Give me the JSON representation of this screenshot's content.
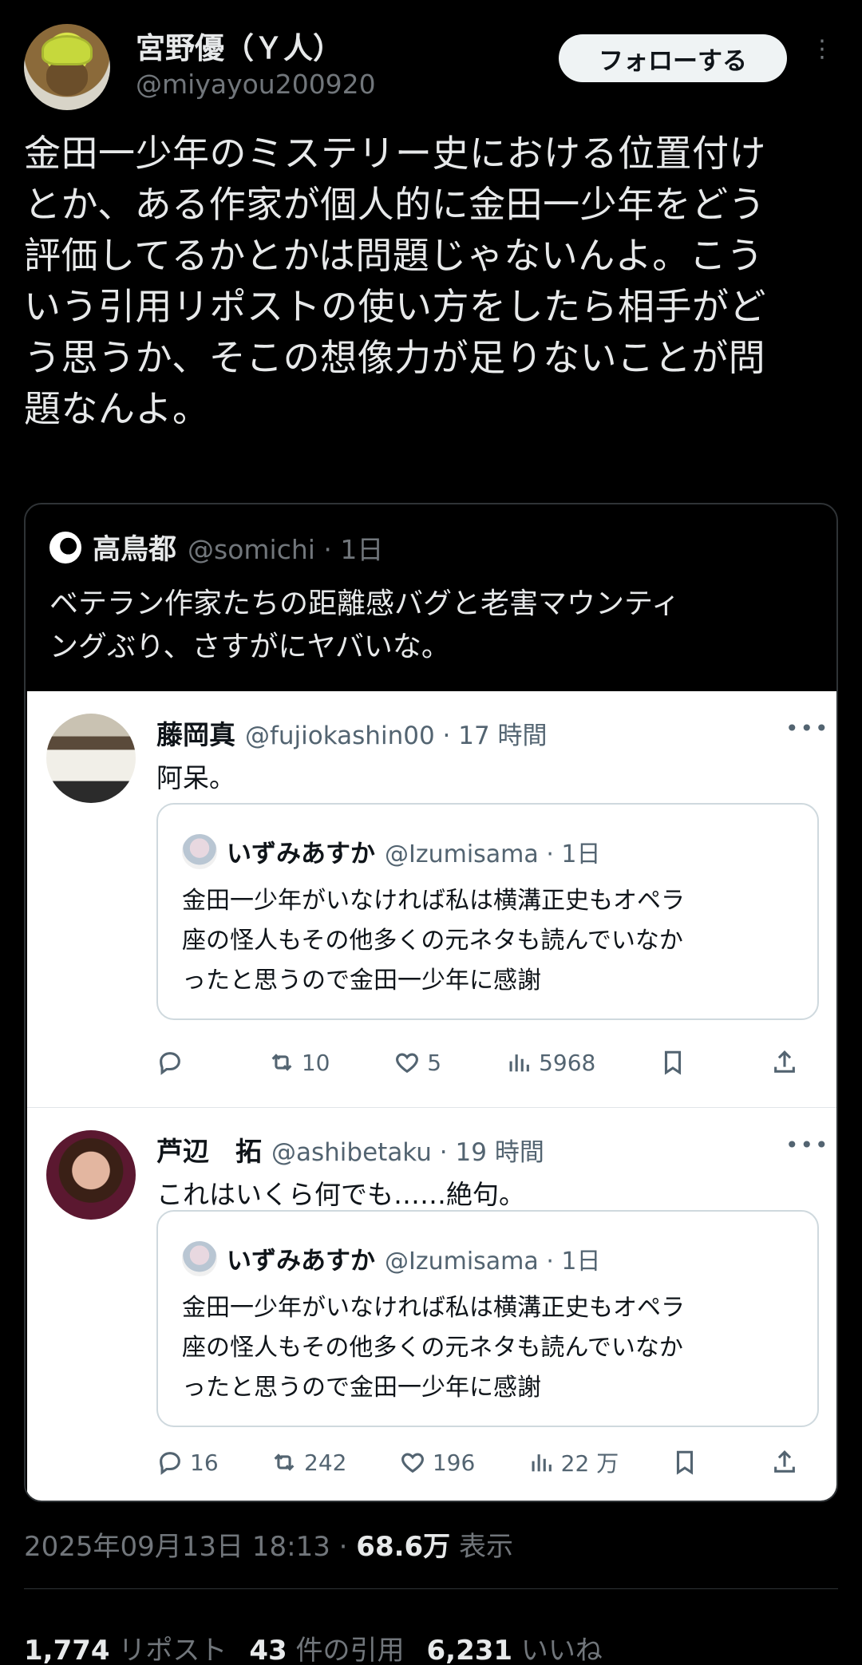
{
  "author": {
    "name": "宮野優（Ｙ人）",
    "handle": "@miyayou200920",
    "follow_label": "フォローする",
    "more_label": "⋮"
  },
  "tweet": {
    "text": "金田一少年のミステリー史における位置付け\nとか、ある作家が個人的に金田一少年をどう\n評価してるかとかは問題じゃないんよ。こう\nいう引用リポストの使い方をしたら相手がど\nう思うか、そこの想像力が足りないことが問\n題なんよ。"
  },
  "quote": {
    "name": "高鳥都",
    "meta": "@somichi · 1日",
    "text": "ベテラン作家たちの距離感バグと老害マウンティ\nングぶり、さすがにヤバいな。"
  },
  "replies": [
    {
      "name": "藤岡真",
      "meta": "@fujiokashin00 · 17 時間",
      "text": "阿呆。",
      "more": "•••",
      "inner": {
        "name": "いずみあすか",
        "meta": "@Izumisama · 1日",
        "text": "金田一少年がいなければ私は横溝正史もオペラ\n座の怪人もその他多くの元ネタも読んでいなか\nったと思うので金田一少年に感謝"
      },
      "actions": {
        "reply": "",
        "repost": "10",
        "like": "5",
        "views": "5968"
      }
    },
    {
      "name": "芦辺　拓",
      "meta": "@ashibetaku · 19 時間",
      "text": "これはいくら何でも……絶句。",
      "more": "•••",
      "inner": {
        "name": "いずみあすか",
        "meta": "@Izumisama · 1日",
        "text": "金田一少年がいなければ私は横溝正史もオペラ\n座の怪人もその他多くの元ネタも読んでいなか\nったと思うので金田一少年に感謝"
      },
      "actions": {
        "reply": "16",
        "repost": "242",
        "like": "196",
        "views": "22 万"
      }
    }
  ],
  "footer": {
    "timestamp": "2025年09月13日 18:13 · ",
    "views_count": "68.6万",
    "views_label": " 表示",
    "reposts_count": "1,774",
    "reposts_label": "リポスト",
    "quotes_count": "43",
    "quotes_label": "件の引用",
    "likes_count": "6,231",
    "likes_label": "いいね"
  }
}
